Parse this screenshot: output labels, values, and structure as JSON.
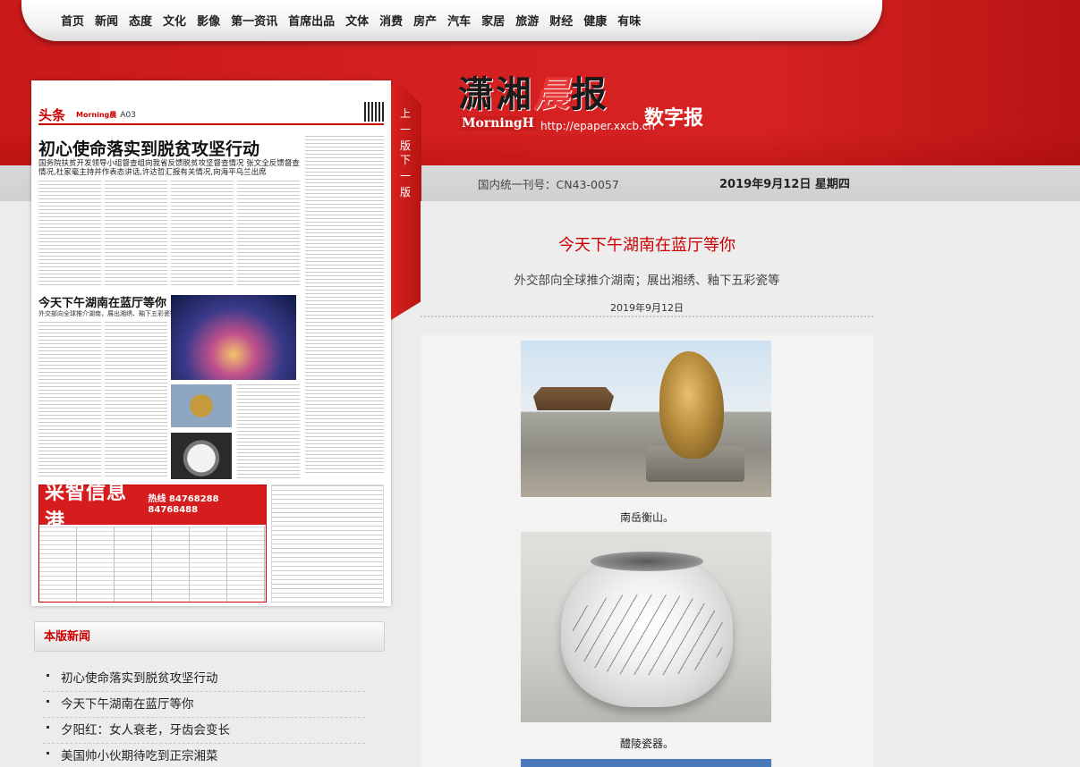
{
  "nav": {
    "items": [
      "首页",
      "新闻",
      "态度",
      "文化",
      "影像",
      "第一资讯",
      "首席出品",
      "文体",
      "消费",
      "房产",
      "汽车",
      "家居",
      "旅游",
      "财经",
      "健康",
      "有味"
    ]
  },
  "masthead": {
    "name_part1": "潇湘",
    "name_part2": "晨",
    "name_part3": "报",
    "name_en": "MorningH",
    "url": "http://epaper.xxcb.cn",
    "subtitle": "数字报"
  },
  "issue": {
    "number": "国内统一刊号：CN43-0057",
    "date": "2019年9月12日 星期四"
  },
  "page_nav": {
    "prev": "上一版",
    "next": "下一版"
  },
  "paper": {
    "section": "头条",
    "logo": "Morning晨",
    "page": "A03",
    "headline1": "初心使命落实到脱贫攻坚行动",
    "headline1_sub": "国务院扶贫开发领导小组督查组向我省反馈脱贫攻坚督查情况  张文全反馈督查情况,杜家毫主持并作表态讲话,许达哲汇报有关情况,向海平乌兰出席",
    "headline2": "今天下午湖南在蓝厅等你",
    "headline2_sub": "外交部向全球推介湖南，展出湘绣、釉下五彩瓷等",
    "ad_title": "采智信息港",
    "ad_hotline": "热线 84768288 84768488"
  },
  "news_box": {
    "title": "本版新闻",
    "items": [
      "初心使命落实到脱贫攻坚行动",
      "今天下午湖南在蓝厅等你",
      "夕阳红：女人衰老，牙齿会变长",
      "美国帅小伙期待吃到正宗湘菜"
    ]
  },
  "article": {
    "title": "今天下午湖南在蓝厅等你",
    "subtitle": "外交部向全球推介湖南；展出湘绣、釉下五彩瓷等",
    "date": "2019年9月12日",
    "captions": [
      "南岳衡山。",
      "醴陵瓷器。"
    ]
  },
  "colors": {
    "brand_red": "#d42020",
    "title_red": "#cc0000"
  }
}
